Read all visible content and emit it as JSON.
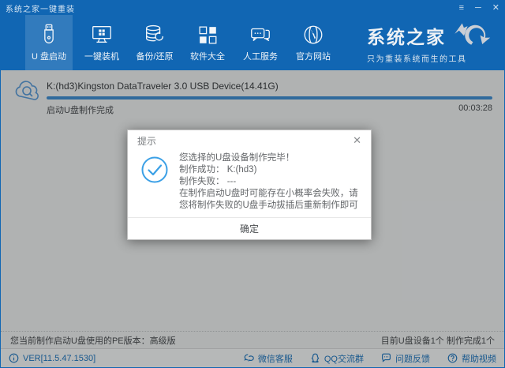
{
  "window": {
    "title": "系统之家一键重装"
  },
  "titlebar_controls": {
    "menu": "≡",
    "minimize": "─",
    "close": "✕"
  },
  "nav": {
    "items": [
      {
        "label": "U 盘启动",
        "icon": "usb-drive-icon",
        "selected": true
      },
      {
        "label": "一键装机",
        "icon": "monitor-windows-icon",
        "selected": false
      },
      {
        "label": "备份/还原",
        "icon": "database-restore-icon",
        "selected": false
      },
      {
        "label": "软件大全",
        "icon": "apps-grid-icon",
        "selected": false
      },
      {
        "label": "人工服务",
        "icon": "chat-service-icon",
        "selected": false
      },
      {
        "label": "官方网站",
        "icon": "globe-icon",
        "selected": false
      }
    ]
  },
  "brand": {
    "name": "系统之家",
    "tagline": "只为重装系统而生的工具",
    "logo_icon": "swoosh-arrows-icon"
  },
  "progress": {
    "device": "K:(hd3)Kingston DataTraveler 3.0 USB Device(14.41G)",
    "status": "启动U盘制作完成",
    "elapsed": "00:03:28",
    "percent": 100
  },
  "dialog": {
    "title": "提示",
    "close": "✕",
    "lines": [
      "您选择的U盘设备制作完毕！",
      "制作成功： K:(hd3)",
      "制作失败： ---",
      "在制作启动U盘时可能存在小概率会失败，请您将制作失败的U盘手动拔插后重新制作即可"
    ],
    "ok_label": "确定"
  },
  "statusbar": {
    "left": "您当前制作启动U盘使用的PE版本：高级版",
    "right": "目前U盘设备1个 制作完成1个"
  },
  "bottombar": {
    "version": "VER[11.5.47.1530]",
    "links": [
      {
        "label": "微信客服",
        "icon": "wechat-icon"
      },
      {
        "label": "QQ交流群",
        "icon": "qq-icon"
      },
      {
        "label": "问题反馈",
        "icon": "feedback-bubble-icon"
      },
      {
        "label": "帮助视频",
        "icon": "help-circle-icon"
      }
    ]
  },
  "colors": {
    "header_blue": "#1166b3",
    "accent_blue": "#2278c0",
    "progress_blue": "#418fd3",
    "check_blue": "#3ba0e6"
  }
}
